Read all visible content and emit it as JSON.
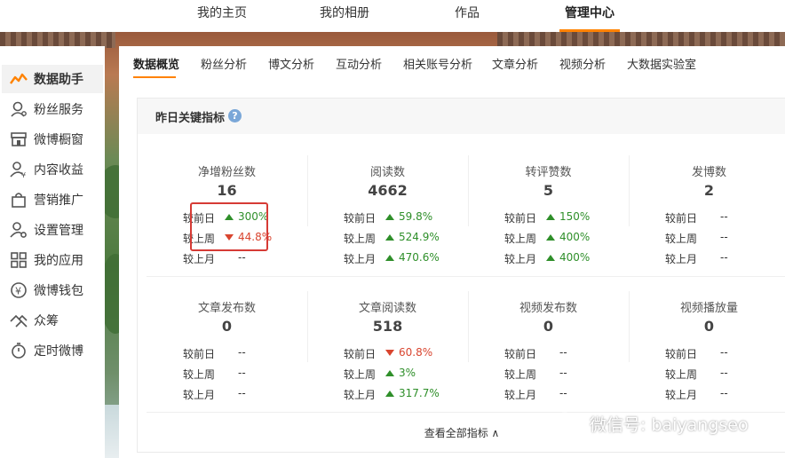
{
  "topnav": {
    "items": [
      {
        "label": "我的主页"
      },
      {
        "label": "我的相册"
      },
      {
        "label": "作品"
      },
      {
        "label": "管理中心"
      }
    ]
  },
  "sidebar": {
    "items": [
      {
        "label": "数据助手",
        "icon": "trend-line-icon"
      },
      {
        "label": "粉丝服务",
        "icon": "fan-person-icon"
      },
      {
        "label": "微博橱窗",
        "icon": "storefront-icon"
      },
      {
        "label": "内容收益",
        "icon": "person-yuan-icon"
      },
      {
        "label": "营销推广",
        "icon": "shopping-bag-icon"
      },
      {
        "label": "设置管理",
        "icon": "person-gear-icon"
      },
      {
        "label": "我的应用",
        "icon": "grid-icon"
      },
      {
        "label": "微博钱包",
        "icon": "wallet-icon"
      },
      {
        "label": "众筹",
        "icon": "crowdfund-icon"
      },
      {
        "label": "定时微博",
        "icon": "stopwatch-icon"
      }
    ]
  },
  "tabs": [
    {
      "label": "数据概览"
    },
    {
      "label": "粉丝分析"
    },
    {
      "label": "博文分析"
    },
    {
      "label": "互动分析"
    },
    {
      "label": "相关账号分析"
    },
    {
      "label": "文章分析"
    },
    {
      "label": "视频分析"
    },
    {
      "label": "大数据实验室"
    }
  ],
  "card": {
    "title": "昨日关键指标",
    "help": "?",
    "view_all": "查看全部指标 ∧",
    "row_labels": {
      "day": "较前日",
      "week": "较上周",
      "month": "较上月"
    },
    "metrics": [
      {
        "label": "净增粉丝数",
        "value": "16",
        "day": "300%",
        "day_dir": "up",
        "week": "44.8%",
        "week_dir": "down",
        "month": "--",
        "month_dir": "none"
      },
      {
        "label": "阅读数",
        "value": "4662",
        "day": "59.8%",
        "day_dir": "up",
        "week": "524.9%",
        "week_dir": "up",
        "month": "470.6%",
        "month_dir": "up"
      },
      {
        "label": "转评赞数",
        "value": "5",
        "day": "150%",
        "day_dir": "up",
        "week": "400%",
        "week_dir": "up",
        "month": "400%",
        "month_dir": "up"
      },
      {
        "label": "发博数",
        "value": "2",
        "day": "--",
        "day_dir": "none",
        "week": "--",
        "week_dir": "none",
        "month": "--",
        "month_dir": "none"
      },
      {
        "label": "文章发布数",
        "value": "0",
        "day": "--",
        "day_dir": "none",
        "week": "--",
        "week_dir": "none",
        "month": "--",
        "month_dir": "none"
      },
      {
        "label": "文章阅读数",
        "value": "518",
        "day": "60.8%",
        "day_dir": "down",
        "week": "3%",
        "week_dir": "up",
        "month": "317.7%",
        "month_dir": "up"
      },
      {
        "label": "视频发布数",
        "value": "0",
        "day": "--",
        "day_dir": "none",
        "week": "--",
        "week_dir": "none",
        "month": "--",
        "month_dir": "none"
      },
      {
        "label": "视频播放量",
        "value": "0",
        "day": "--",
        "day_dir": "none",
        "week": "--",
        "week_dir": "none",
        "month": "--",
        "month_dir": "none"
      }
    ]
  },
  "watermark": {
    "text": "微信号: baiyangseo",
    "icon": "wechat-icon"
  },
  "colors": {
    "accent": "#ff8200",
    "up": "#2f8f2a",
    "down": "#d9452f",
    "highlight": "#d63b35"
  }
}
